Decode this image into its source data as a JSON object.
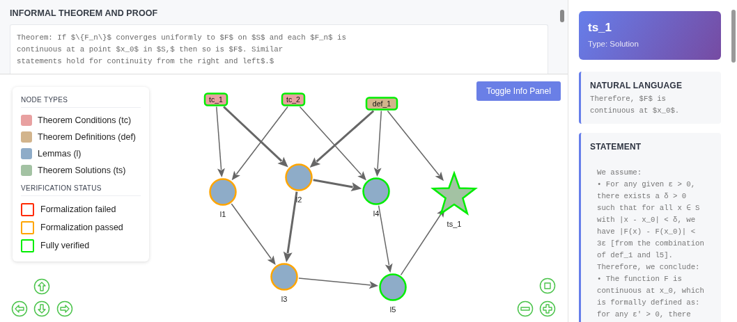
{
  "informal_panel": {
    "title": "INFORMAL THEOREM AND PROOF",
    "lines": [
      "Theorem: If $\\{F_n\\}$ converges uniformly to $F$ on $S$ and each $F_n$ is",
      "continuous at a point $x_0$ in $S,$ then so is $F$. Similar",
      "statements hold for continuity from the right and left$.$"
    ]
  },
  "legend": {
    "node_types_title": "NODE TYPES",
    "node_types": [
      {
        "label": "Theorem Conditions (tc)",
        "color": "#e8a0a0"
      },
      {
        "label": "Theorem Definitions (def)",
        "color": "#d2b48c"
      },
      {
        "label": "Lemmas (l)",
        "color": "#8eacc8"
      },
      {
        "label": "Theorem Solutions (ts)",
        "color": "#a3c2a3"
      }
    ],
    "status_title": "VERIFICATION STATUS",
    "statuses": [
      {
        "label": "Formalization failed",
        "color": "#ff2a00"
      },
      {
        "label": "Formalization passed",
        "color": "#ffa500"
      },
      {
        "label": "Fully verified",
        "color": "#00ee00"
      }
    ]
  },
  "toggle_button": "Toggle Info Panel",
  "graph": {
    "nodes": [
      {
        "label": "tc_1",
        "kind": "tc",
        "verified": true
      },
      {
        "label": "tc_2",
        "kind": "tc",
        "verified": true
      },
      {
        "label": "def_1",
        "kind": "def",
        "verified": true
      },
      {
        "label": "l1",
        "kind": "l",
        "verified": false
      },
      {
        "label": "l2",
        "kind": "l",
        "verified": false
      },
      {
        "label": "l4",
        "kind": "l",
        "verified": true
      },
      {
        "label": "ts_1",
        "kind": "ts",
        "verified": true
      },
      {
        "label": "l3",
        "kind": "l",
        "verified": false
      },
      {
        "label": "l5",
        "kind": "l",
        "verified": true
      }
    ],
    "edges": [
      {
        "strong": false
      },
      {
        "strong": true
      },
      {
        "strong": false
      },
      {
        "strong": false
      },
      {
        "strong": true
      },
      {
        "strong": false
      },
      {
        "strong": false
      },
      {
        "strong": false
      },
      {
        "strong": true
      },
      {
        "strong": true
      },
      {
        "strong": false
      },
      {
        "strong": false
      },
      {
        "strong": false
      }
    ]
  },
  "info_panel": {
    "title": "ts_1",
    "subtitle": "Type: Solution",
    "sections": [
      {
        "heading": "NATURAL LANGUAGE",
        "kind": "text",
        "lines": [
          "Therefore, $F$ is",
          "continuous at $x_0$."
        ]
      },
      {
        "heading": "STATEMENT",
        "kind": "pre",
        "lines": [
          "We assume:",
          "• For any given ε > 0,",
          "there exists a δ > 0",
          "such that for all x ∈ S",
          "with |x - x_0| < δ, we",
          "have |F(x) - F(x_0)| <",
          "3ε [from the combination",
          "of def_1 and l5].",
          "Therefore, we conclude:",
          "• The function F is",
          "continuous at x_0, which",
          "is formally defined as:",
          "for any ε' > 0, there"
        ]
      }
    ]
  }
}
